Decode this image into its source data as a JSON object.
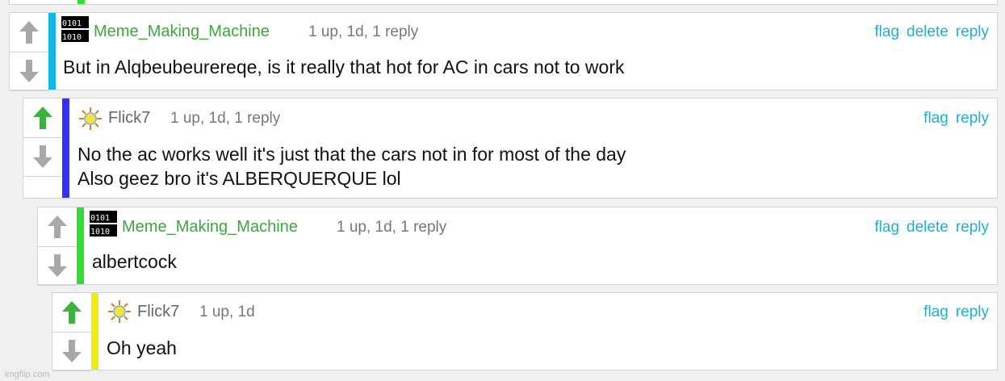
{
  "colors": {
    "accent_link": "#1bb0d6",
    "username": "#3fa63f",
    "up_active": "#3cb33c",
    "vote_inactive": "#a8a8a8",
    "bar_cyan": "#13b7e8",
    "bar_blue": "#3434f0",
    "bar_green": "#33dd33",
    "bar_yellow": "#eeee11"
  },
  "comments": [
    {
      "username": "Meme_Making_Machine",
      "avatar_icon": "binary-avatar-icon",
      "meta": "1 up, 1d, 1 reply",
      "actions": [
        "flag",
        "delete",
        "reply"
      ],
      "body_lines": [
        "But in Alqbeubeurereqe, is it really that hot for AC in cars not to work"
      ],
      "upvoted": false
    },
    {
      "username": "Flick7",
      "avatar_icon": "sun-avatar-icon",
      "meta": "1 up, 1d, 1 reply",
      "actions": [
        "flag",
        "reply"
      ],
      "body_lines": [
        "No the ac works well it's just that the cars not in for most of the day",
        "Also geez bro it's ALBERQUERQUE lol"
      ],
      "upvoted": true
    },
    {
      "username": "Meme_Making_Machine",
      "avatar_icon": "binary-avatar-icon",
      "meta": "1 up, 1d, 1 reply",
      "actions": [
        "flag",
        "delete",
        "reply"
      ],
      "body_lines": [
        "albertcock"
      ],
      "upvoted": false
    },
    {
      "username": "Flick7",
      "avatar_icon": "sun-avatar-icon",
      "meta": "1 up, 1d",
      "actions": [
        "flag",
        "reply"
      ],
      "body_lines": [
        "Oh yeah"
      ],
      "upvoted": true
    }
  ],
  "watermark": "imgflip.com"
}
